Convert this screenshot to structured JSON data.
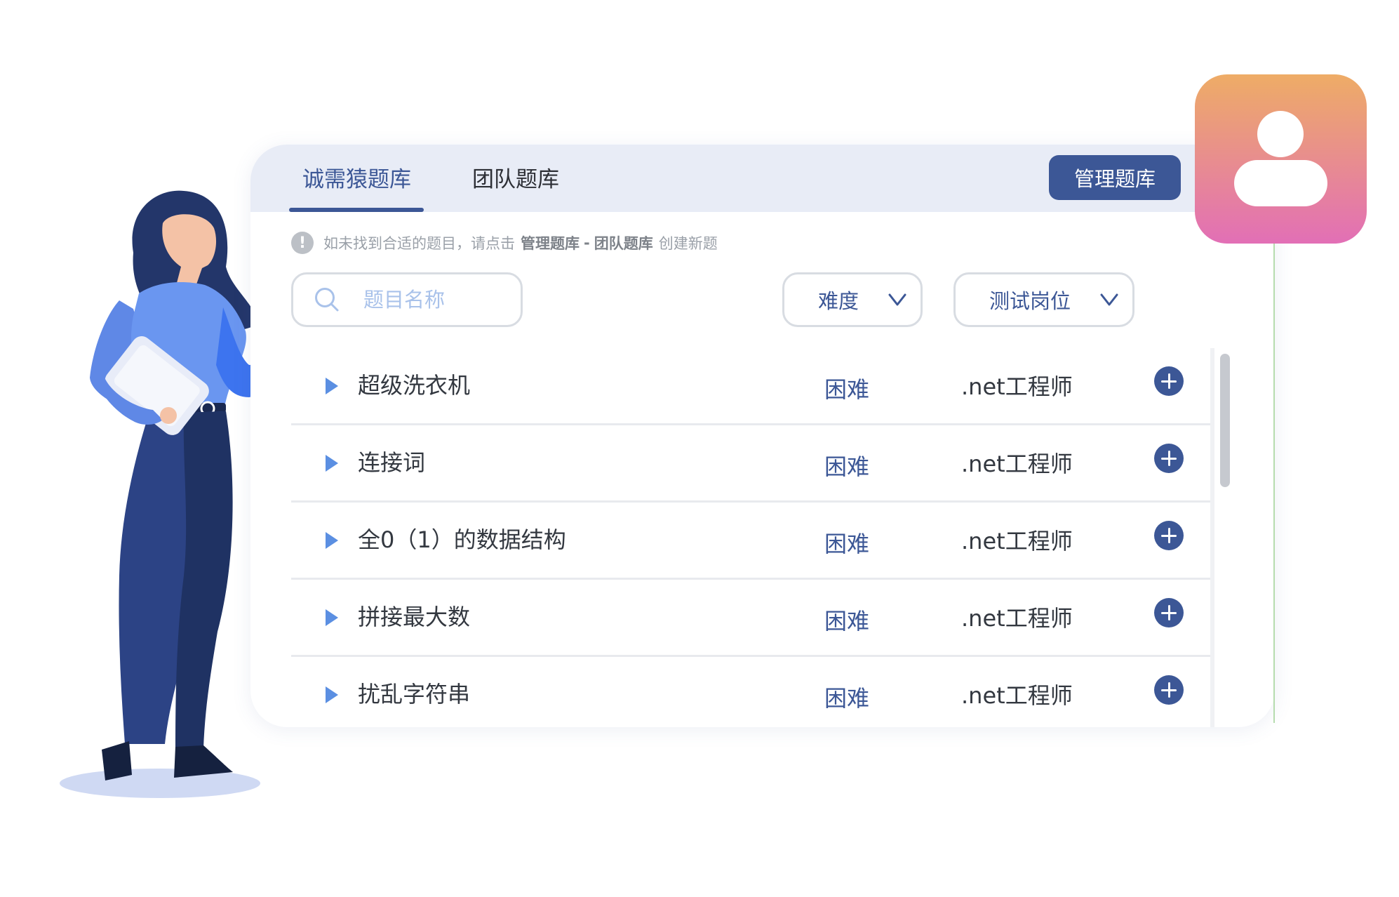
{
  "tabs": [
    {
      "label": "诚需猿题库",
      "active": true
    },
    {
      "label": "团队题库",
      "active": false
    }
  ],
  "manage_button": "管理题库",
  "notice": {
    "prefix": "如未找到合适的题目，请点击",
    "link1": "管理题库",
    "sep": "-",
    "link2": "团队题库",
    "suffix": "创建新题"
  },
  "search": {
    "placeholder": "题目名称",
    "value": ""
  },
  "filters": {
    "difficulty": "难度",
    "position": "测试岗位"
  },
  "questions": [
    {
      "name": "超级洗衣机",
      "difficulty": "困难",
      "position": ".net工程师"
    },
    {
      "name": "连接词",
      "difficulty": "困难",
      "position": ".net工程师"
    },
    {
      "name": "全0（1）的数据结构",
      "difficulty": "困难",
      "position": ".net工程师"
    },
    {
      "name": "拼接最大数",
      "difficulty": "困难",
      "position": ".net工程师"
    },
    {
      "name": "扰乱字符串",
      "difficulty": "困难",
      "position": ".net工程师"
    }
  ],
  "icons": {
    "search": "search-icon",
    "chevron": "chevron-down-icon",
    "add": "plus-circle-icon",
    "expand": "caret-right-icon",
    "warning": "exclamation-icon",
    "user": "user-icon"
  },
  "colors": {
    "accent": "#3c5796",
    "tab_bar": "#e8ecf6",
    "expand_arrow": "#5b8fe2",
    "user_tile_top": "#eeac66",
    "user_tile_bottom": "#e26fb6"
  }
}
